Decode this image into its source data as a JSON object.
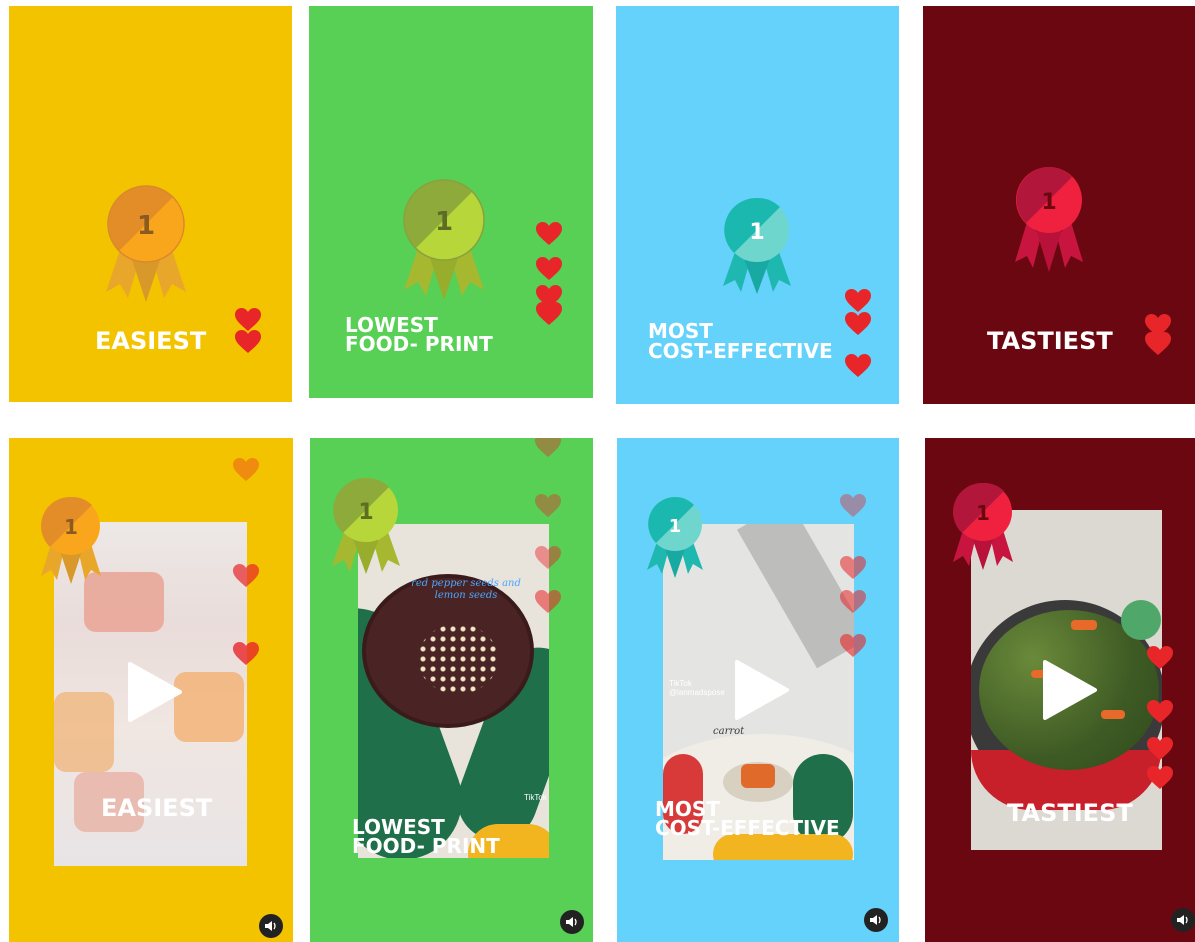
{
  "top_row": [
    {
      "label": "EASIEST",
      "rank": "1"
    },
    {
      "label_line1": "LOWEST",
      "label_line2": "FOOD- PRINT",
      "rank": "1"
    },
    {
      "label_line1": "MOST",
      "label_line2": "COST-EFFECTIVE",
      "rank": "1"
    },
    {
      "label": "TASTIEST",
      "rank": "1"
    }
  ],
  "bottom_row": [
    {
      "label": "EASIEST",
      "rank": "1"
    },
    {
      "label_line1": "LOWEST",
      "label_line2": "FOOD- PRINT",
      "rank": "1",
      "handwritten": "red pepper seeds and lemon seeds",
      "tiktok_label": "TikTok"
    },
    {
      "label_line1": "MOST",
      "label_line2": "COST-EFFECTIVE",
      "rank": "1",
      "tiktok_label": "TikTok",
      "tiktok_handle": "@lanmadspose",
      "handwritten": "carrot"
    },
    {
      "label": "TASTIEST",
      "rank": "1"
    }
  ],
  "colors": {
    "yellow": "#f4c300",
    "green": "#57d055",
    "blue": "#64d2fb",
    "maroon": "#6b0711",
    "heart": "#e8262a"
  },
  "icons": {
    "medal": "medal-icon",
    "heart": "heart-icon",
    "play": "play-icon",
    "sound": "speaker-icon"
  }
}
